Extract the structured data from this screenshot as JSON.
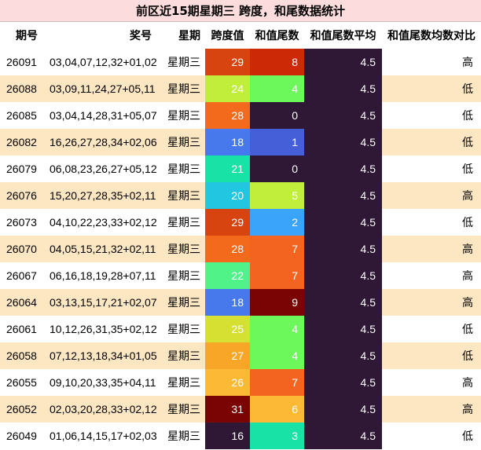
{
  "title": "前区近15期星期三 跨度，和尾数据统计",
  "headers": {
    "issue": "期号",
    "numbers": "奖号",
    "weekday": "星期",
    "span": "跨度值",
    "tail": "和值尾数",
    "avg": "和值尾数平均",
    "compare": "和值尾数均数对比"
  },
  "rows": [
    {
      "issue": "26091",
      "numbers": "03,04,07,12,32+01,02",
      "weekday": "星期三",
      "span": "29",
      "span_color": "#d84410",
      "tail": "8",
      "tail_color": "#cc2a06",
      "avg": "4.5",
      "compare": "高"
    },
    {
      "issue": "26088",
      "numbers": "03,09,11,24,27+05,11",
      "weekday": "星期三",
      "span": "24",
      "span_color": "#c1ee3b",
      "tail": "4",
      "tail_color": "#6cf75a",
      "avg": "4.5",
      "compare": "低"
    },
    {
      "issue": "26085",
      "numbers": "03,04,14,28,31+05,07",
      "weekday": "星期三",
      "span": "28",
      "span_color": "#f36a1d",
      "tail": "0",
      "tail_color": "#2e1836",
      "avg": "4.5",
      "compare": "低"
    },
    {
      "issue": "26082",
      "numbers": "16,26,27,28,34+02,06",
      "weekday": "星期三",
      "span": "18",
      "span_color": "#4779ec",
      "tail": "1",
      "tail_color": "#455fd8",
      "avg": "4.5",
      "compare": "低"
    },
    {
      "issue": "26079",
      "numbers": "06,08,23,26,27+05,12",
      "weekday": "星期三",
      "span": "21",
      "span_color": "#19e2a7",
      "tail": "0",
      "tail_color": "#2e1836",
      "avg": "4.5",
      "compare": "低"
    },
    {
      "issue": "26076",
      "numbers": "15,20,27,28,35+02,11",
      "weekday": "星期三",
      "span": "20",
      "span_color": "#22c6e1",
      "tail": "5",
      "tail_color": "#c1ee3b",
      "avg": "4.5",
      "compare": "高"
    },
    {
      "issue": "26073",
      "numbers": "04,10,22,23,33+02,12",
      "weekday": "星期三",
      "span": "29",
      "span_color": "#d84410",
      "tail": "2",
      "tail_color": "#3aa3fa",
      "avg": "4.5",
      "compare": "低"
    },
    {
      "issue": "26070",
      "numbers": "04,05,15,21,32+02,11",
      "weekday": "星期三",
      "span": "28",
      "span_color": "#f36a1d",
      "tail": "7",
      "tail_color": "#f26420",
      "avg": "4.5",
      "compare": "高"
    },
    {
      "issue": "26067",
      "numbers": "06,16,18,19,28+07,11",
      "weekday": "星期三",
      "span": "22",
      "span_color": "#4ff387",
      "tail": "7",
      "tail_color": "#f26420",
      "avg": "4.5",
      "compare": "高"
    },
    {
      "issue": "26064",
      "numbers": "03,13,15,17,21+02,07",
      "weekday": "星期三",
      "span": "18",
      "span_color": "#4779ec",
      "tail": "9",
      "tail_color": "#7a0403",
      "avg": "4.5",
      "compare": "高"
    },
    {
      "issue": "26061",
      "numbers": "10,12,26,31,35+02,12",
      "weekday": "星期三",
      "span": "25",
      "span_color": "#d5e032",
      "tail": "4",
      "tail_color": "#6cf75a",
      "avg": "4.5",
      "compare": "低"
    },
    {
      "issue": "26058",
      "numbers": "07,12,13,18,34+01,05",
      "weekday": "星期三",
      "span": "27",
      "span_color": "#f7a628",
      "tail": "4",
      "tail_color": "#6cf75a",
      "avg": "4.5",
      "compare": "低"
    },
    {
      "issue": "26055",
      "numbers": "09,10,20,33,35+04,11",
      "weekday": "星期三",
      "span": "26",
      "span_color": "#fcb935",
      "tail": "7",
      "tail_color": "#f26420",
      "avg": "4.5",
      "compare": "高"
    },
    {
      "issue": "26052",
      "numbers": "02,03,20,28,33+02,12",
      "weekday": "星期三",
      "span": "31",
      "span_color": "#7a0403",
      "tail": "6",
      "tail_color": "#fcb935",
      "avg": "4.5",
      "compare": "高"
    },
    {
      "issue": "26049",
      "numbers": "01,06,14,15,17+02,03",
      "weekday": "星期三",
      "span": "16",
      "span_color": "#2e1836",
      "tail": "3",
      "tail_color": "#19e2a7",
      "avg": "4.5",
      "compare": "低"
    }
  ]
}
